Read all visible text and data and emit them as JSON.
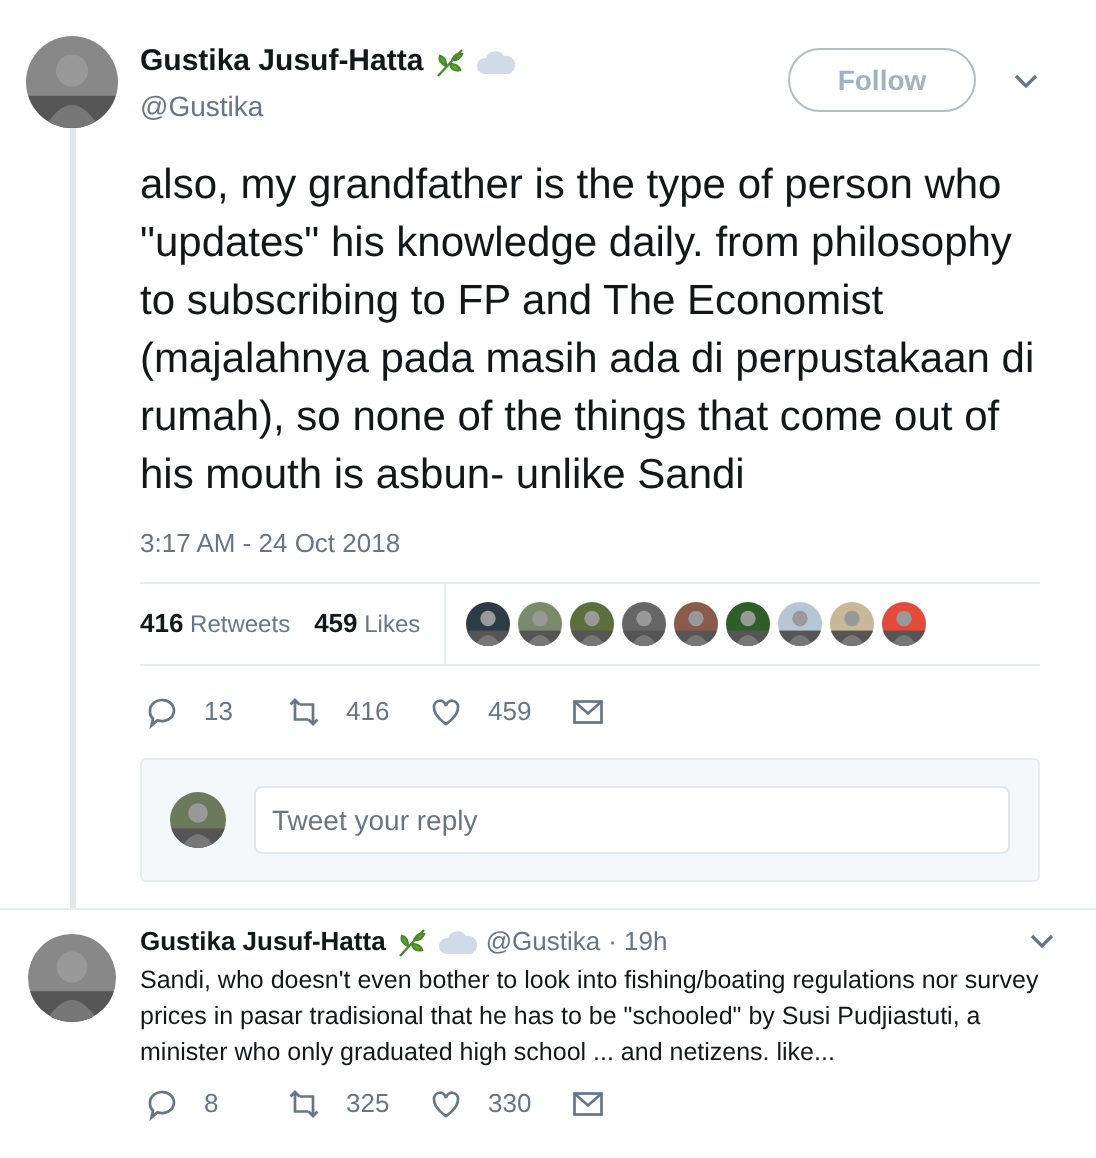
{
  "tweet": {
    "author": {
      "name": "Gustika Jusuf-Hatta",
      "handle": "@Gustika"
    },
    "follow_button": "Follow",
    "text": "also, my grandfather is the type of person who \"updates\" his knowledge daily. from philosophy to subscribing to FP and The Economist (majalahnya pada masih ada di perpustakaan di rumah), so none of the things that come out of his mouth is asbun- unlike Sandi",
    "timestamp": "3:17 AM - 24 Oct 2018",
    "stats": [
      {
        "count": "416",
        "label": "Retweets"
      },
      {
        "count": "459",
        "label": "Likes"
      }
    ],
    "actions": [
      {
        "kind": "reply",
        "count": "13"
      },
      {
        "kind": "retweet",
        "count": "416"
      },
      {
        "kind": "like",
        "count": "459"
      },
      {
        "kind": "message"
      }
    ],
    "reply_box": {
      "placeholder": "Tweet your reply"
    }
  },
  "reply": {
    "author": {
      "name": "Gustika Jusuf-Hatta",
      "handle": "@Gustika",
      "time": "· 19h"
    },
    "text": "Sandi, who doesn't even bother to look into fishing/boating regulations nor survey prices in pasar tradisional that he has to be \"schooled\" by Susi Pudjiastuti, a minister who only graduated high school ... and netizens. like...",
    "actions": [
      {
        "kind": "reply",
        "count": "8"
      },
      {
        "kind": "retweet",
        "count": "325"
      },
      {
        "kind": "like",
        "count": "330"
      },
      {
        "kind": "message"
      }
    ]
  }
}
